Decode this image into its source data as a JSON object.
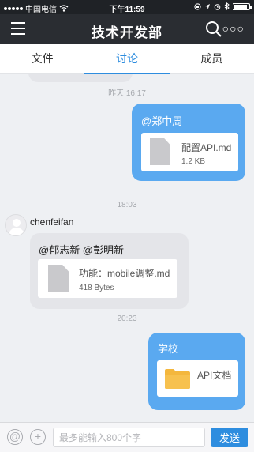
{
  "status_bar": {
    "carrier": "中国电信",
    "time": "下午11:59",
    "icons": [
      "signal-icon",
      "wifi-icon",
      "orientation-lock-icon",
      "location-icon",
      "alarm-icon",
      "bluetooth-icon",
      "battery-icon"
    ]
  },
  "header": {
    "title": "技术开发部",
    "menu_icon": "hamburger-menu-icon",
    "search_icon": "search-icon",
    "more_icon": "more-icon",
    "more_glyph": "○○○"
  },
  "tabs": [
    {
      "label": "文件",
      "active": false
    },
    {
      "label": "讨论",
      "active": true
    },
    {
      "label": "成员",
      "active": false
    }
  ],
  "messages": [
    {
      "timestamp": "昨天 16:17",
      "side": "right",
      "mention": "@郑中周",
      "file": {
        "name": "配置API.md",
        "size": "1.2 KB",
        "icon": "document-icon"
      }
    },
    {
      "timestamp": "18:03",
      "side": "left",
      "sender": "chenfeifan",
      "mention": "@郁志新 @彭明新",
      "file": {
        "name": "功能：mobile调整.md",
        "size": "418 Bytes",
        "icon": "document-icon"
      }
    },
    {
      "timestamp": "20:23",
      "side": "right",
      "mention": "学校",
      "file": {
        "name": "API文档",
        "icon": "folder-icon"
      }
    }
  ],
  "input_bar": {
    "placeholder": "最多能输入800个字",
    "value": "",
    "send_label": "发送",
    "mention_glyph": "@",
    "add_glyph": "+"
  },
  "colors": {
    "accent": "#2e8ddf",
    "bubble_right": "#5aa9f0",
    "bubble_left": "#e4e5e9",
    "nav_bg": "#2a2d32",
    "folder": "#f4b73d"
  }
}
